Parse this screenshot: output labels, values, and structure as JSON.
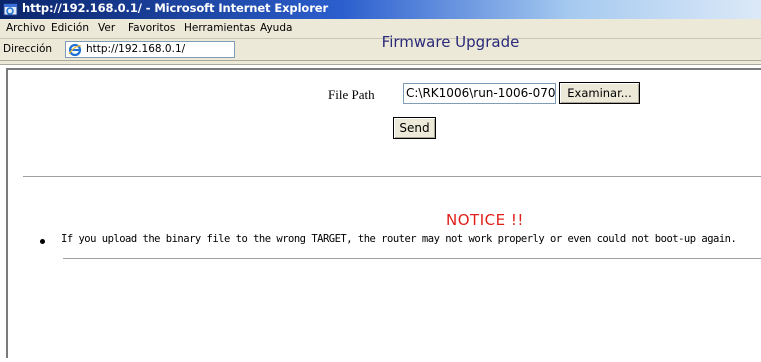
{
  "window": {
    "title": "http://192.168.0.1/ - Microsoft Internet Explorer"
  },
  "menubar": {
    "items": [
      {
        "label": "Archivo"
      },
      {
        "label": "Edición"
      },
      {
        "label": "Ver"
      },
      {
        "label": "Favoritos"
      },
      {
        "label": "Herramientas"
      },
      {
        "label": "Ayuda"
      }
    ]
  },
  "addressbar": {
    "label": "Dirección",
    "url": "http://192.168.0.1/"
  },
  "page": {
    "heading": "Firmware Upgrade",
    "file_label": "File Path",
    "file_value": "C:\\RK1006\\run-1006-070",
    "browse_label": "Examinar...",
    "send_label": "Send",
    "notice_title": "NOTICE !!",
    "notice_text": "If you upload the binary file to the wrong TARGET, the router may not work properly or even could not boot-up again."
  },
  "colors": {
    "titlebar": "#0a246a",
    "heading": "#2a2a7a",
    "notice": "#e0201b"
  },
  "icons": {
    "title_icon": "ie-window-icon",
    "address_icon": "ie-page-icon"
  }
}
